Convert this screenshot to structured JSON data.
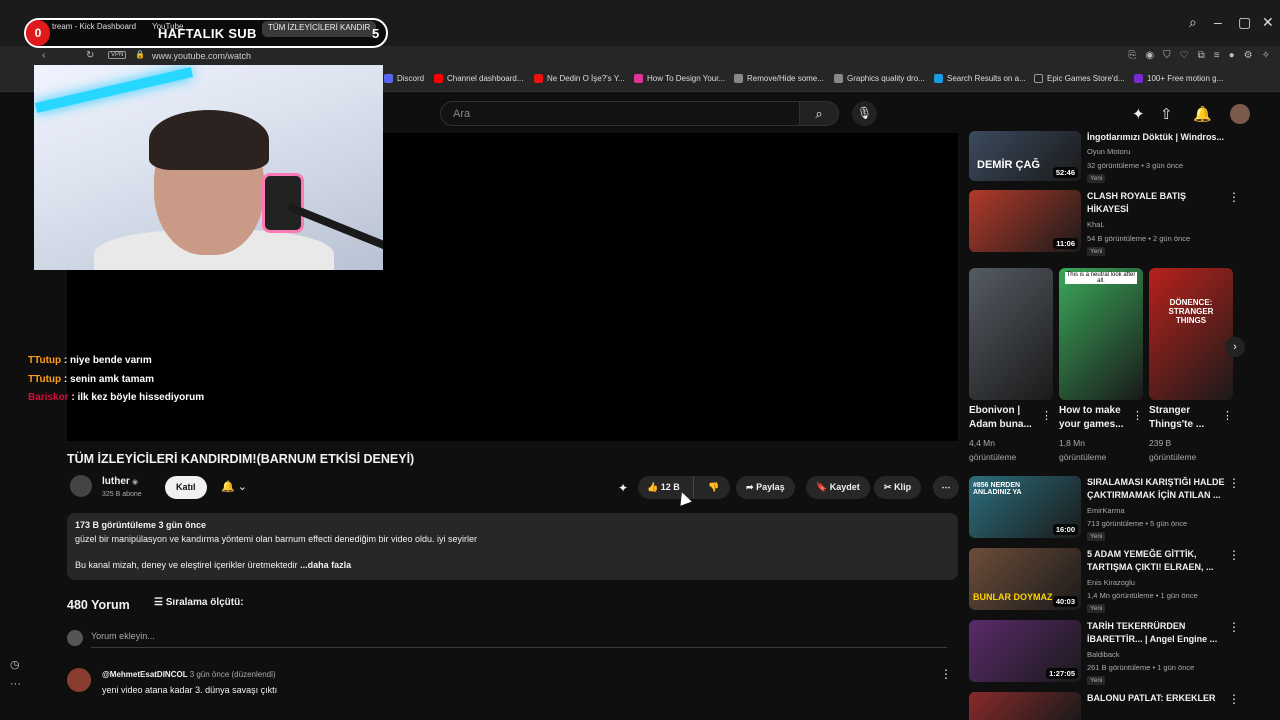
{
  "browser": {
    "tabs": [
      "tream - Kick Dashboard",
      "YouTube",
      "TÜM İZLEYİCİLERİ KANDIR"
    ],
    "vpn_label": "VPN",
    "url": "www.youtube.com/watch",
    "bookmarks": [
      "Discord",
      "Channel dashboard...",
      "Ne Dedin O İşe?'s Y...",
      "How To Design Your...",
      "Remove/Hide some...",
      "Graphics quality dro...",
      "Search Results on a...",
      "Epic Games Store'd...",
      "100+ Free motion g..."
    ]
  },
  "overlay": {
    "sub_count": "0",
    "sub_title": "HAFTALIK SUB",
    "sub_goal": "5"
  },
  "chat": [
    {
      "user": "TTutup",
      "message": ": niye bende varım"
    },
    {
      "user": "TTutup",
      "message": ": senin amk tamam"
    },
    {
      "user": "Bariskor",
      "message": ": ilk kez böyle hissediyorum"
    }
  ],
  "search": {
    "placeholder": "Ara"
  },
  "video": {
    "title": "TÜM İZLEYİCİLERİ KANDIRDIM!(BARNUM ETKİSİ DENEYİ)",
    "channel": "luther",
    "subscribers": "325 B abone",
    "join_label": "Katıl",
    "likes": "12 B",
    "share_label": "Paylaş",
    "save_label": "Kaydet",
    "clip_label": "Klip",
    "views_date": "173 B görüntüleme  3 gün önce",
    "desc_line1": "güzel bir manipülasyon ve kandırma yöntemi olan barnum effecti denediğim bir video oldu. iyi seyirler",
    "desc_line2": "Bu kanal mizah, deney ve eleştirel içerikler üretmektedir",
    "desc_more": "...daha fazla"
  },
  "comments": {
    "count": "480 Yorum",
    "sort_label": "Sıralama ölçütü:",
    "add_placeholder": "Yorum ekleyin...",
    "items": [
      {
        "user": "@MehmetEsatDINCOL",
        "meta": "3 gün önce (düzenlendi)",
        "text": "yeni video atana kadar 3. dünya savaşı çıktı"
      }
    ]
  },
  "recommendations": [
    {
      "title": "İngotlarımızı Döktük | Windros...",
      "channel": "Oyun Motoru",
      "meta": "32 görüntüleme • 3 gün önce",
      "badge": "Yeni",
      "duration": "52:46",
      "thumb_text": "DEMİR ÇAĞ",
      "color": "#3b4a5e"
    },
    {
      "title": "CLASH ROYALE BATIŞ HİKAYESİ",
      "channel": "KhaL",
      "meta": "54 B görüntüleme • 2 gün önce",
      "badge": "Yeni",
      "duration": "11:06",
      "thumb_text": "",
      "color": "#b23a2a"
    },
    {
      "title": "SIRALAMASI KARIŞTIĞI HALDE ÇAKTIRMAMAK İÇİN ATILAN ...",
      "channel": "EmirKarma",
      "meta": "713 görüntüleme • 5 gün önce",
      "badge": "Yeni",
      "duration": "16:00",
      "thumb_text": "#856 NERDEN ANLADINIZ YA",
      "color": "#2b6f7d"
    },
    {
      "title": "5 ADAM YEMEĞE GİTTİK, TARTIŞMA ÇIKTI! ELRAEN, ...",
      "channel": "Enis Kirazoglu",
      "meta": "1,4 Mn görüntüleme • 1 gün önce",
      "badge": "Yeni",
      "duration": "40:03",
      "thumb_text": "BUNLAR DOYMAZ",
      "color": "#6d4d3a"
    },
    {
      "title": "TARİH TEKERRÜRDEN İBARETTİR... | Angel Engine ...",
      "channel": "Baldiback",
      "meta": "261 B görüntüleme • 1 gün önce",
      "badge": "Yeni",
      "duration": "1:27:05",
      "thumb_text": "",
      "color": "#5a2a6a"
    },
    {
      "title": "BALONU PATLAT: ERKEKLER",
      "channel": "",
      "meta": "",
      "badge": "",
      "duration": "",
      "thumb_text": "",
      "color": "#8a2a2a"
    }
  ],
  "shorts": [
    {
      "title": "Ebonivon | Adam buna...",
      "views": "4,4 Mn görüntüleme",
      "thumb_text": "",
      "color": "#555b63"
    },
    {
      "title": "How to make your games...",
      "views": "1,8 Mn görüntüleme",
      "thumb_text": "This is a neutral look after all.",
      "color": "#3aa85a"
    },
    {
      "title": "Stranger Things'te ...",
      "views": "239 B görüntüleme",
      "thumb_text": "DÖNENCE: STRANGER THINGS",
      "color": "#b8221b"
    }
  ]
}
